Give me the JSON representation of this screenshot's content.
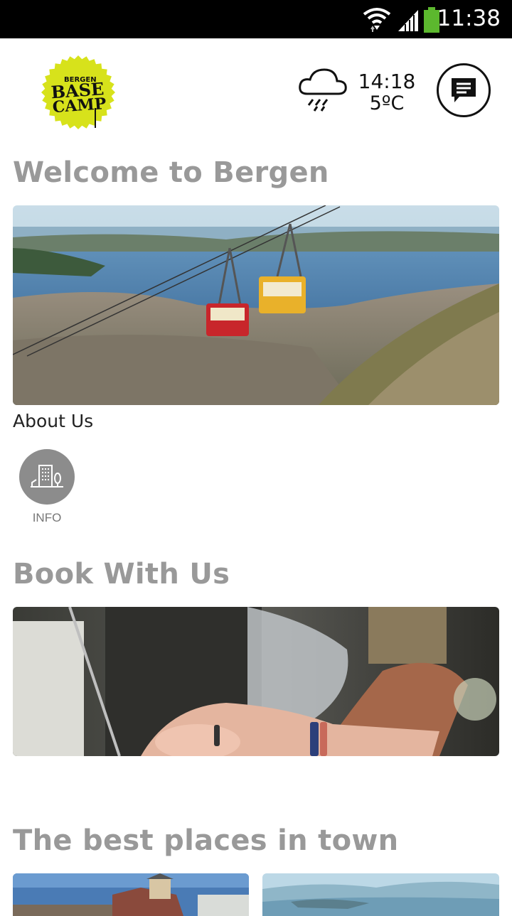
{
  "status_bar": {
    "time": "11:38",
    "icons": [
      "wifi-icon",
      "signal-icon",
      "battery-icon"
    ],
    "battery_color": "#5cb82e"
  },
  "header": {
    "logo": {
      "line1": "BERGEN",
      "line2": "BASE",
      "line3": "CAMP",
      "color": "#d7e21b"
    },
    "weather": {
      "icon": "rain-cloud-icon",
      "time": "14:18",
      "temperature": "5ºC"
    },
    "chat_icon": "chat-icon"
  },
  "sections": {
    "welcome": {
      "title": "Welcome to Bergen",
      "image": "bergen-cable-car-photo",
      "link_label": "About Us",
      "shortcut": {
        "label": "INFO",
        "icon": "building-icon"
      }
    },
    "book": {
      "title": "Book With Us",
      "image": "laptop-typing-photo"
    },
    "places": {
      "title": "The best places in town",
      "thumbnails": [
        "town-houses-photo",
        "fjord-photo"
      ]
    }
  },
  "colors": {
    "section_title": "#999999",
    "info_circle": "#8c8c8c"
  }
}
